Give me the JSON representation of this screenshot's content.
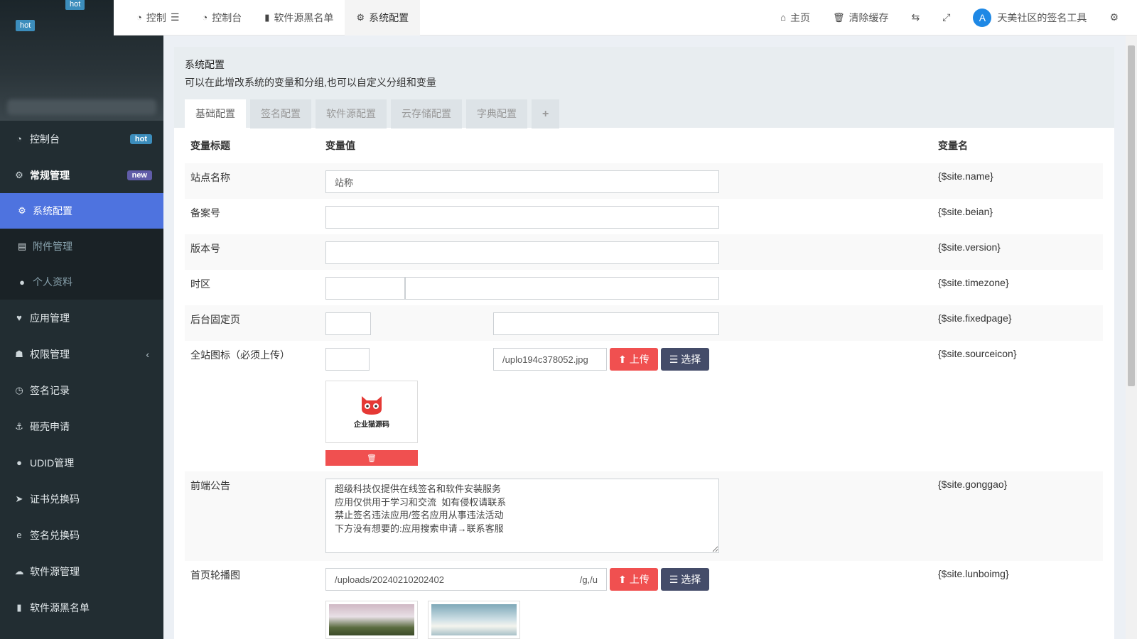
{
  "sidebar": {
    "logo_tags": [
      "hot",
      "hot"
    ],
    "items": [
      {
        "label": "控制台",
        "badge": "hot",
        "icon": "dashboard-icon"
      },
      {
        "label": "常规管理",
        "badge": "new",
        "icon": "cogs-icon"
      },
      {
        "label": "系统配置",
        "icon": "gear-icon"
      },
      {
        "label": "附件管理",
        "icon": "file-icon"
      },
      {
        "label": "个人资料",
        "icon": "user-icon"
      },
      {
        "label": "应用管理",
        "icon": "heart-icon"
      },
      {
        "label": "权限管理",
        "icon": "users-icon"
      },
      {
        "label": "签名记录",
        "icon": "clock-icon"
      },
      {
        "label": "砸壳申请",
        "icon": "anchor-icon"
      },
      {
        "label": "UDID管理",
        "icon": "apple-icon"
      },
      {
        "label": "证书兑换码",
        "icon": "send-icon"
      },
      {
        "label": "签名兑换码",
        "icon": "edge-icon"
      },
      {
        "label": "软件源管理",
        "icon": "cloud-icon"
      },
      {
        "label": "软件源黑名单",
        "icon": "book-icon"
      }
    ]
  },
  "topbar": {
    "tabs": [
      {
        "label": "控制台",
        "icon": "dashboard-icon"
      },
      {
        "label": "软件源黑名单",
        "icon": "book-icon"
      },
      {
        "label": "系统配置",
        "icon": "gear-icon"
      }
    ],
    "first_label": "控制",
    "home": "主页",
    "clear_cache": "清除缓存",
    "user_name": "天美社区的签名工具"
  },
  "panel": {
    "title": "系统配置",
    "subtitle": "可以在此增改系统的变量和分组,也可以自定义分组和变量",
    "tabs": [
      "基础配置",
      "签名配置",
      "软件源配置",
      "云存储配置",
      "字典配置"
    ],
    "add_tab": "+"
  },
  "table": {
    "headers": {
      "title": "变量标题",
      "value": "变量值",
      "name": "变量名"
    },
    "rows": {
      "site_name": {
        "label": "站点名称",
        "value": "站称",
        "var": "{$site.name}"
      },
      "beian": {
        "label": "备案号",
        "value": "",
        "var": "{$site.beian}"
      },
      "version": {
        "label": "版本号",
        "value": "",
        "var": "{$site.version}"
      },
      "timezone": {
        "label": "时区",
        "value": "",
        "var": "{$site.timezone}"
      },
      "fixedpage": {
        "label": "后台固定页",
        "value": "",
        "var": "{$site.fixedpage}"
      },
      "sourceicon": {
        "label": "全站图标（必须上传）",
        "value": "/uplo194c378052.jpg",
        "var": "{$site.sourceicon}",
        "upload": "上传",
        "select": "选择",
        "logo_text": "企业猫源码"
      },
      "gonggao": {
        "label": "前端公告",
        "value": "超级科技仅提供在线签名和软件安装服务\n应用仅供用于学习和交流  如有侵权请联系\n禁止签名违法应用/签名应用从事违法活动\n下方没有想要的:应用搜索申请→联系客服",
        "var": "{$site.gonggao}"
      },
      "lunboimg": {
        "label": "首页轮播图",
        "value_left": "/uploads/20240210202402",
        "value_right": "/g,/u",
        "var": "{$site.lunboimg}",
        "upload": "上传",
        "select": "选择"
      }
    }
  }
}
